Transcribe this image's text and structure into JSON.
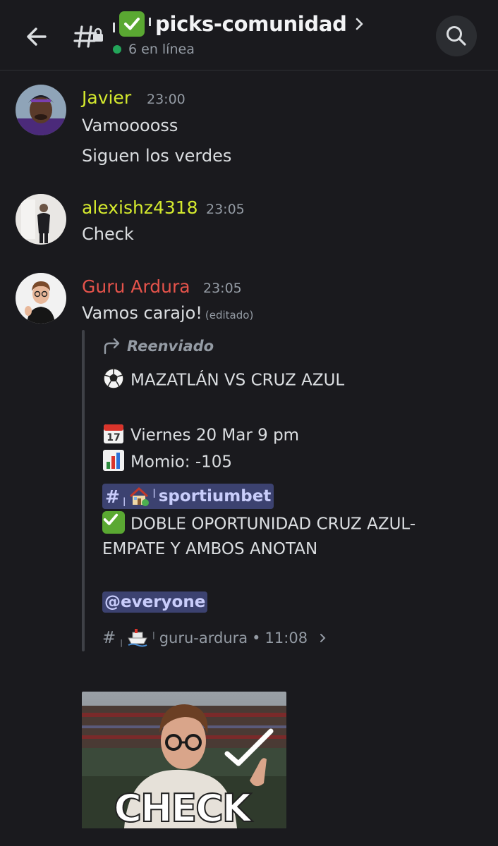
{
  "header": {
    "channel_name": "picks-comunidad",
    "online_text": "6 en línea"
  },
  "messages": [
    {
      "username": "Javier",
      "username_color": "#d4e92e",
      "time": "23:00",
      "lines": [
        "Vamooooss",
        "Siguen los verdes"
      ]
    },
    {
      "username": "alexishz4318",
      "username_color": "#d4e92e",
      "time": "23:05",
      "lines": [
        "Check"
      ]
    },
    {
      "username": "Guru Ardura",
      "username_color": "#e5534b",
      "time": "23:05",
      "text": "Vamos carajo!",
      "edited": "(editado)",
      "forwarded": {
        "label": "Reenviado",
        "match": "MAZATLÁN VS CRUZ AZUL",
        "date": "Viernes 20 Mar 9 pm",
        "odds": "Momio: -105",
        "channel_mention": "sportiumbet",
        "pick_line1": "DOBLE OPORTUNIDAD CRUZ AZUL-",
        "pick_line2": "EMPATE Y AMBOS ANOTAN",
        "mention": "@everyone",
        "source_channel": "guru-ardura",
        "source_time": "11:08",
        "bullet": "•"
      },
      "gif_text": "CHECK"
    }
  ],
  "colors": {
    "background": "#1a1a1e",
    "muted": "#949ba4",
    "mention_bg": "#3c4270",
    "online": "#23a55a"
  }
}
